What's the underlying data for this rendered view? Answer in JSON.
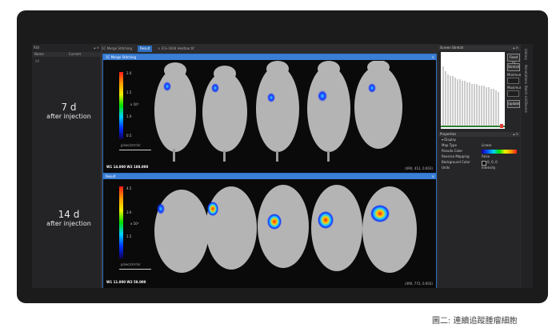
{
  "left_panel": {
    "title": "ROI",
    "controls": "▴ ×",
    "columns": [
      "Name",
      "Current"
    ],
    "row": "All"
  },
  "labels": [
    {
      "day": "7 d",
      "sub": "after injection"
    },
    {
      "day": "14 d",
      "sub": "after injection"
    }
  ],
  "tabs": [
    {
      "label": "1C Merge Stitching",
      "active": false
    },
    {
      "label": "Result",
      "active": true
    },
    {
      "label": "×  ICG-1604 Heatbar.tif",
      "active": false
    }
  ],
  "pane_top": {
    "title": "1C Merge Stitching",
    "close": "×",
    "ticks": [
      "2.0",
      "1.5",
      "1.0",
      "0.5"
    ],
    "exponent": "x 10⁶",
    "unit": "p/sec/cm²/sr",
    "w_info": "W1 14.000   W2 188.000",
    "coord": "(490, 412, 0.003)"
  },
  "pane_bottom": {
    "title": "Result",
    "close": "×",
    "ticks": [
      "4.5",
      "3.0",
      "1.5"
    ],
    "exponent": "x 10⁶",
    "unit": "p/sec/cm²/sr",
    "w_info": "W1 11.000   W2 58.000",
    "coord": "(490, 772, 0.003)"
  },
  "right_panel": {
    "histogram_title": "Screen Stretch",
    "buttons": {
      "fit": "Fixed Fit",
      "stretch": "Stretch",
      "update": "Update"
    },
    "min_label": "Minimum",
    "min_value": "",
    "max_label": "Maximum",
    "max_value": "",
    "properties_title": "Properties",
    "display_label": "Display",
    "props": [
      {
        "name": "Map Type",
        "value": "Linear"
      },
      {
        "name": "Pseudo Color",
        "value": ""
      },
      {
        "name": "Reverse Mapping",
        "value": "False"
      },
      {
        "name": "Background Color",
        "value": "0, 0, 0"
      },
      {
        "name": "Units",
        "value": "Intensity"
      }
    ],
    "close": "▴ ×"
  },
  "right_strip": [
    "Library",
    "Annotations",
    "Batch List",
    "Device"
  ],
  "caption": "圖二: 連續追蹤腫瘤細胞"
}
